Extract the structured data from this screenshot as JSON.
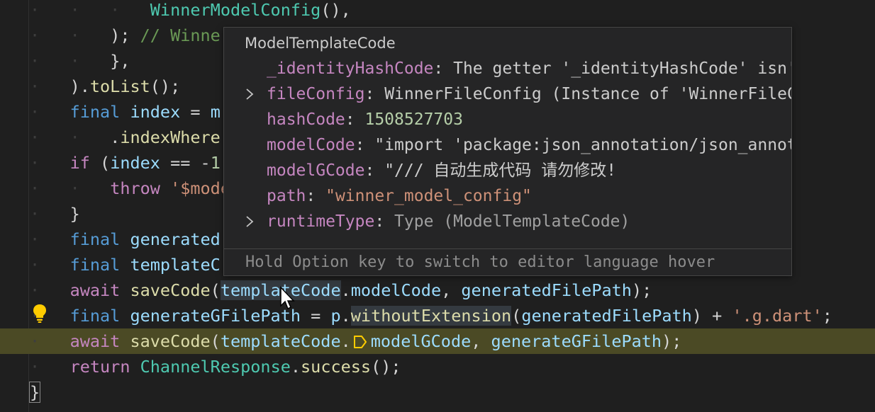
{
  "editor": {
    "lines": [
      {
        "indent": "·   ·   ·   ",
        "tokens": [
          {
            "t": "WinnerModelConfig",
            "c": "cls"
          },
          {
            "t": "(),",
            "c": "punc"
          }
        ]
      },
      {
        "indent": "·   ·   ",
        "tokens": [
          {
            "t": "); ",
            "c": "punc"
          },
          {
            "t": "// Winne",
            "c": "cmt"
          }
        ]
      },
      {
        "indent": "·   ·   ",
        "tokens": [
          {
            "t": "},",
            "c": "punc"
          }
        ]
      },
      {
        "indent": "·   ",
        "tokens": [
          {
            "t": ").",
            "c": "punc"
          },
          {
            "t": "toList",
            "c": "fn"
          },
          {
            "t": "();",
            "c": "punc"
          }
        ]
      },
      {
        "indent": "·   ",
        "tokens": [
          {
            "t": "final ",
            "c": "kw"
          },
          {
            "t": "index",
            "c": "var"
          },
          {
            "t": " = ",
            "c": "punc"
          },
          {
            "t": "m",
            "c": "var"
          }
        ]
      },
      {
        "indent": "·   ·   ",
        "tokens": [
          {
            "t": ".",
            "c": "punc"
          },
          {
            "t": "indexWhere",
            "c": "fn"
          }
        ]
      },
      {
        "indent": "·   ",
        "tokens": [
          {
            "t": "if ",
            "c": "ctrl"
          },
          {
            "t": "(",
            "c": "punc"
          },
          {
            "t": "index",
            "c": "var"
          },
          {
            "t": " == -",
            "c": "punc"
          },
          {
            "t": "1",
            "c": "num"
          }
        ]
      },
      {
        "indent": "·   ·   ",
        "tokens": [
          {
            "t": "throw ",
            "c": "ctrl"
          },
          {
            "t": "'$model",
            "c": "str"
          }
        ]
      },
      {
        "indent": "·   ",
        "tokens": [
          {
            "t": "}",
            "c": "punc"
          }
        ]
      },
      {
        "indent": "·   ",
        "tokens": [
          {
            "t": "final ",
            "c": "kw"
          },
          {
            "t": "generated",
            "c": "var"
          }
        ]
      },
      {
        "indent": "·   ",
        "tokens": [
          {
            "t": "final ",
            "c": "kw"
          },
          {
            "t": "templateC",
            "c": "var"
          }
        ]
      },
      {
        "indent": "·   ",
        "tokens": [
          {
            "t": "await ",
            "c": "ctrl"
          },
          {
            "t": "saveCode",
            "c": "fn"
          },
          {
            "t": "(",
            "c": "punc"
          },
          {
            "t": "templateCode",
            "c": "var wordhl"
          },
          {
            "t": ".",
            "c": "punc"
          },
          {
            "t": "modelCode",
            "c": "var"
          },
          {
            "t": ", ",
            "c": "punc"
          },
          {
            "t": "generatedFilePath",
            "c": "var"
          },
          {
            "t": ");",
            "c": "punc"
          }
        ]
      },
      {
        "indent": "·   ",
        "tokens": [
          {
            "t": "final ",
            "c": "kw"
          },
          {
            "t": "generateGFilePath",
            "c": "var"
          },
          {
            "t": " = ",
            "c": "punc"
          },
          {
            "t": "p",
            "c": "var"
          },
          {
            "t": ".",
            "c": "punc"
          },
          {
            "t": "withoutExtension",
            "c": "fn wordhl"
          },
          {
            "t": "(",
            "c": "punc"
          },
          {
            "t": "generatedFilePath",
            "c": "var"
          },
          {
            "t": ") + ",
            "c": "punc"
          },
          {
            "t": "'.g.dart'",
            "c": "str"
          },
          {
            "t": ";",
            "c": "punc"
          }
        ]
      },
      {
        "indent": "·   ",
        "tokens": [
          {
            "t": "await ",
            "c": "ctrl"
          },
          {
            "t": "saveCode",
            "c": "fn"
          },
          {
            "t": "(",
            "c": "punc"
          },
          {
            "t": "templateCode",
            "c": "var"
          },
          {
            "t": ".",
            "c": "punc"
          },
          {
            "t": "@BP",
            "c": "bp"
          },
          {
            "t": "modelGCode",
            "c": "var"
          },
          {
            "t": ", ",
            "c": "punc"
          },
          {
            "t": "generateGFilePath",
            "c": "var"
          },
          {
            "t": ");",
            "c": "punc"
          }
        ]
      },
      {
        "indent": "·   ",
        "tokens": [
          {
            "t": "return ",
            "c": "ctrl"
          },
          {
            "t": "ChannelResponse",
            "c": "cls"
          },
          {
            "t": ".",
            "c": "punc"
          },
          {
            "t": "success",
            "c": "fn"
          },
          {
            "t": "();",
            "c": "punc"
          }
        ]
      },
      {
        "indent": "",
        "tokens": [
          {
            "t": "}",
            "c": "punc bracket-box"
          }
        ]
      }
    ]
  },
  "hover": {
    "title": "ModelTemplateCode",
    "rows": [
      {
        "expandable": false,
        "name": "_identityHashCode",
        "value": "The getter '_identityHashCode' isn't d",
        "vclass": "pval"
      },
      {
        "expandable": true,
        "name": "fileConfig",
        "value": "WinnerFileConfig (Instance of 'WinnerFileCon",
        "vclass": "pval"
      },
      {
        "expandable": false,
        "name": "hashCode",
        "value": "1508527703",
        "vclass": "num"
      },
      {
        "expandable": false,
        "name": "modelCode",
        "value": "\"import 'package:json_annotation/json_annotat",
        "vclass": "pval"
      },
      {
        "expandable": false,
        "name": "modelGCode",
        "value": "\"/// 自动生成代码 请勿修改!",
        "vclass": "pval"
      },
      {
        "expandable": false,
        "name": "path",
        "value": "\"winner_model_config\"",
        "vclass": "str"
      },
      {
        "expandable": true,
        "name": "runtimeType",
        "value": "Type (ModelTemplateCode)",
        "vclass": "pvaltype"
      }
    ],
    "footer": "Hold Option key to switch to editor language hover"
  },
  "icons": {
    "lightbulb": "lightbulb-icon",
    "breakpoint": "debug-stackframe-icon",
    "chevron": "chevron-right-icon",
    "cursor": "mouse-pointer-icon"
  },
  "colors": {
    "background": "#1f1f1f",
    "current_line_highlight": "#4b4a25",
    "lightbulb": "#ffcc00",
    "breakpoint": "#ffcc00"
  }
}
